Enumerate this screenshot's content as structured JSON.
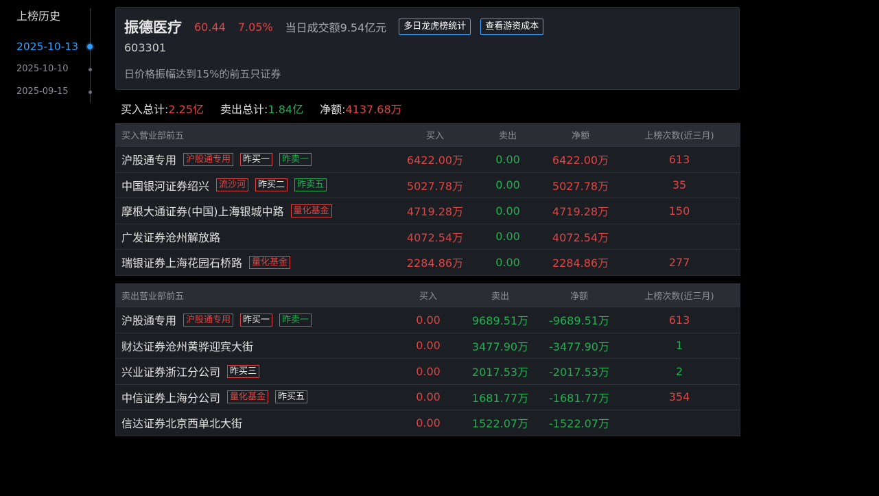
{
  "sidebar": {
    "title": "上榜历史",
    "dates": [
      {
        "date": "2025-10-13",
        "active": true
      },
      {
        "date": "2025-10-10",
        "active": false
      },
      {
        "date": "2025-09-15",
        "active": false
      }
    ]
  },
  "stock": {
    "name": "振德医疗",
    "price": "60.44",
    "change_pct": "7.05%",
    "turnover": "当日成交额9.54亿元",
    "code": "603301",
    "reason": "日价格振幅达到15%的前五只证券",
    "btn_multi_day": "多日龙虎榜统计",
    "btn_cost": "查看游资成本"
  },
  "totals": {
    "buy_label": "买入总计:",
    "buy_value": "2.25亿",
    "sell_label": "卖出总计:",
    "sell_value": "1.84亿",
    "net_label": "净额:",
    "net_value": "4137.68万"
  },
  "buy_table": {
    "headers": {
      "name": "买入营业部前五",
      "buy": "买入",
      "sell": "卖出",
      "net": "净额",
      "count": "上榜次数(近三月)"
    },
    "rows": [
      {
        "name": "沪股通专用",
        "tags": [
          {
            "text": "沪股通专用",
            "style": "red"
          },
          {
            "text": "昨买一",
            "style": "white"
          },
          {
            "text": "昨卖一",
            "style": "green"
          }
        ],
        "buy": "6422.00万",
        "sell": "0.00",
        "net": "6422.00万",
        "count": "613"
      },
      {
        "name": "中国银河证券绍兴",
        "tags": [
          {
            "text": "流沙河",
            "style": "red"
          },
          {
            "text": "昨买二",
            "style": "white"
          },
          {
            "text": "昨卖五",
            "style": "green"
          }
        ],
        "buy": "5027.78万",
        "sell": "0.00",
        "net": "5027.78万",
        "count": "35"
      },
      {
        "name": "摩根大通证券(中国)上海银城中路",
        "tags": [
          {
            "text": "量化基金",
            "style": "red"
          }
        ],
        "buy": "4719.28万",
        "sell": "0.00",
        "net": "4719.28万",
        "count": "150"
      },
      {
        "name": "广发证券沧州解放路",
        "tags": [],
        "buy": "4072.54万",
        "sell": "0.00",
        "net": "4072.54万",
        "count": ""
      },
      {
        "name": "瑞银证券上海花园石桥路",
        "tags": [
          {
            "text": "量化基金",
            "style": "red"
          }
        ],
        "buy": "2284.86万",
        "sell": "0.00",
        "net": "2284.86万",
        "count": "277"
      }
    ]
  },
  "sell_table": {
    "headers": {
      "name": "卖出营业部前五",
      "buy": "买入",
      "sell": "卖出",
      "net": "净额",
      "count": "上榜次数(近三月)"
    },
    "rows": [
      {
        "name": "沪股通专用",
        "tags": [
          {
            "text": "沪股通专用",
            "style": "red"
          },
          {
            "text": "昨买一",
            "style": "white"
          },
          {
            "text": "昨卖一",
            "style": "green"
          }
        ],
        "buy": "0.00",
        "sell": "9689.51万",
        "net": "-9689.51万",
        "count": "613"
      },
      {
        "name": "财达证券沧州黄骅迎宾大街",
        "tags": [],
        "buy": "0.00",
        "sell": "3477.90万",
        "net": "-3477.90万",
        "count": "1"
      },
      {
        "name": "兴业证券浙江分公司",
        "tags": [
          {
            "text": "昨买三",
            "style": "white"
          }
        ],
        "buy": "0.00",
        "sell": "2017.53万",
        "net": "-2017.53万",
        "count": "2"
      },
      {
        "name": "中信证券上海分公司",
        "tags": [
          {
            "text": "量化基金",
            "style": "red"
          },
          {
            "text": "昨买五",
            "style": "white"
          }
        ],
        "buy": "0.00",
        "sell": "1681.77万",
        "net": "-1681.77万",
        "count": "354"
      },
      {
        "name": "信达证券北京西单北大街",
        "tags": [],
        "buy": "0.00",
        "sell": "1522.07万",
        "net": "-1522.07万",
        "count": ""
      }
    ]
  },
  "colors": {
    "up": "#e04545",
    "down": "#21b04f",
    "accent": "#2f9bff"
  }
}
